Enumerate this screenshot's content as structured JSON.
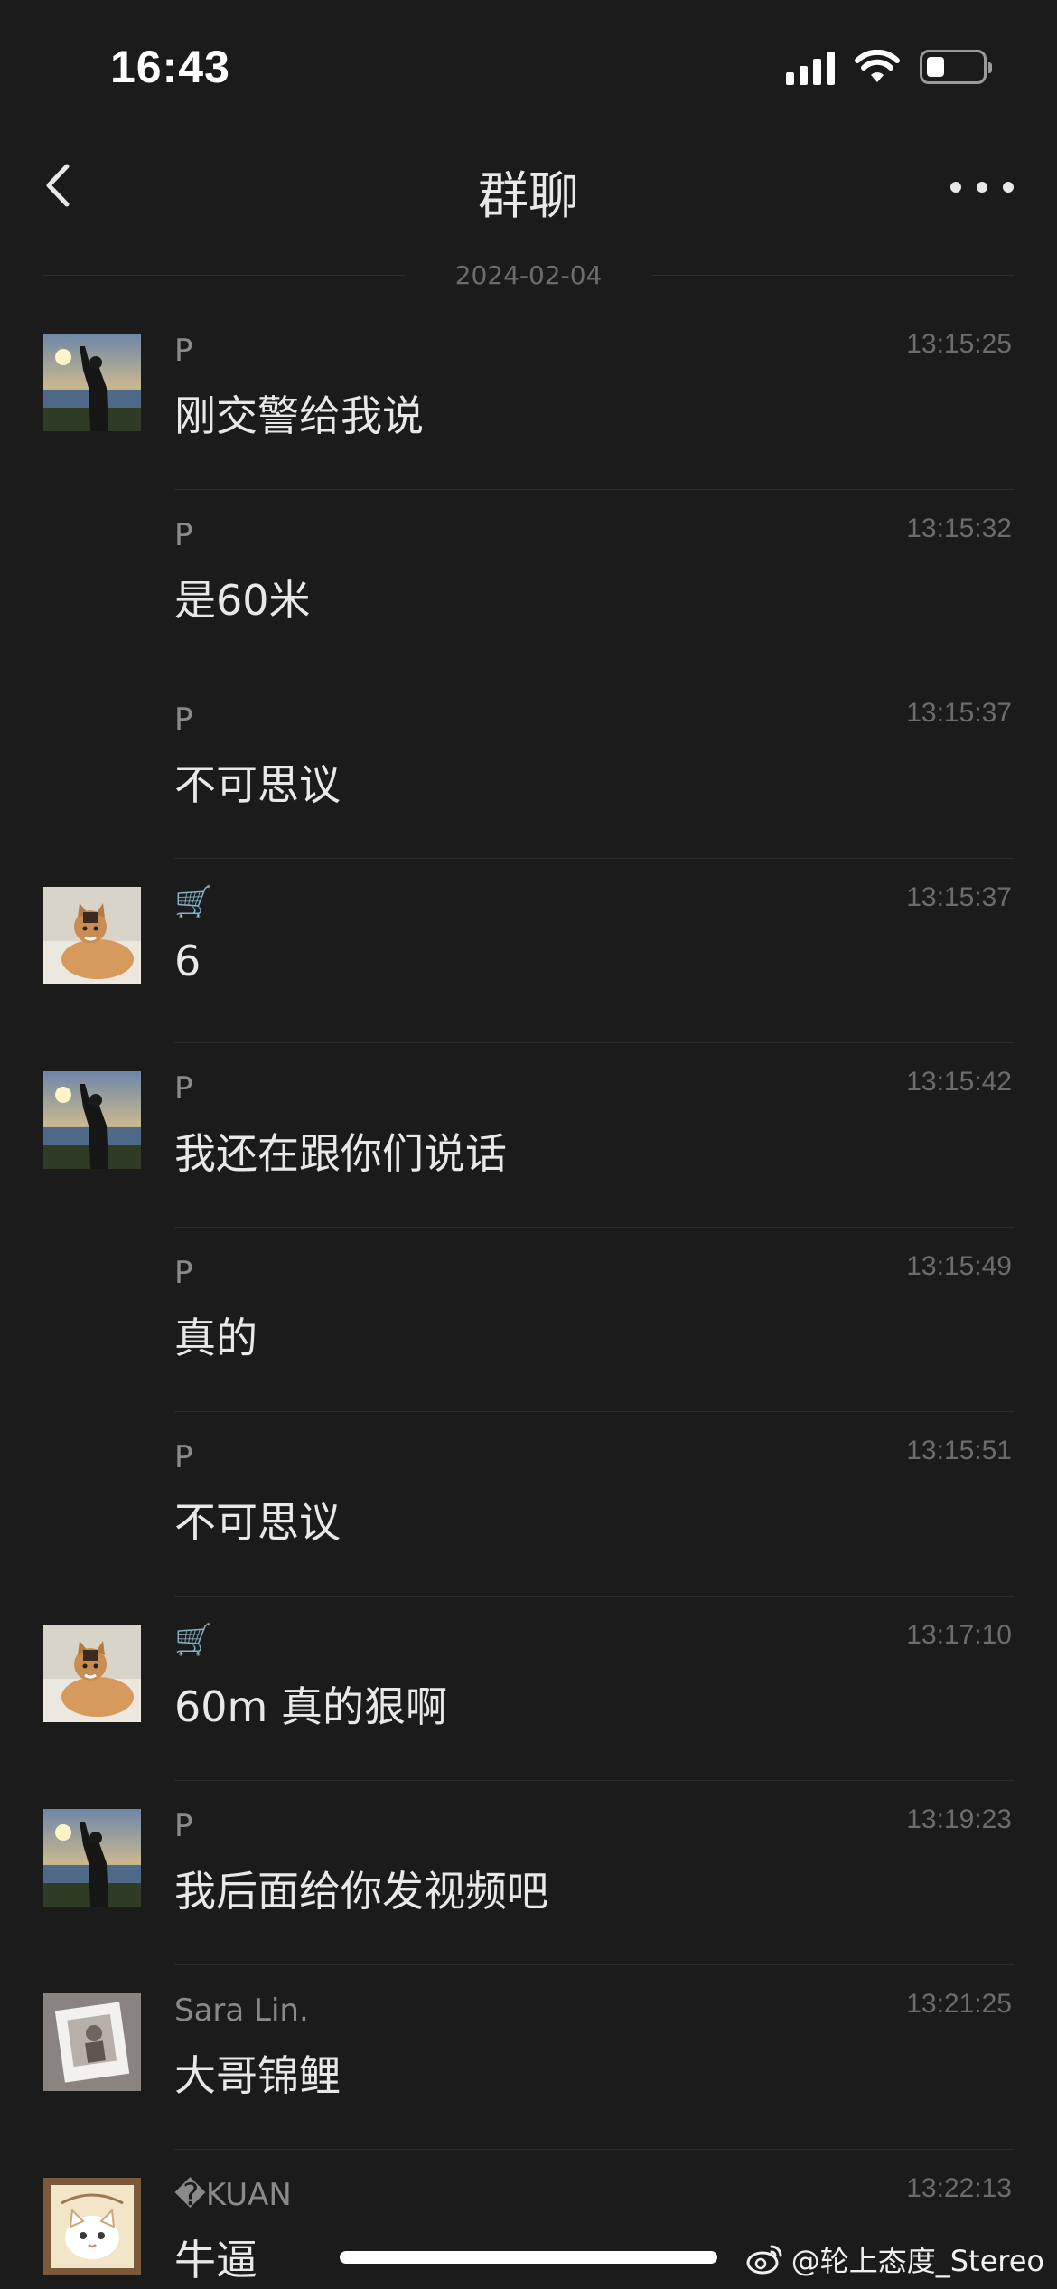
{
  "status_bar": {
    "time": "16:43",
    "battery_level": 0.3
  },
  "nav": {
    "title": "群聊"
  },
  "date_divider": "2024-02-04",
  "messages": [
    {
      "sender": "P",
      "time": "13:15:25",
      "text": "刚交警给我说",
      "avatar": "avatar-person-sunset",
      "show_avatar": true
    },
    {
      "sender": "P",
      "time": "13:15:32",
      "text": "是60米",
      "avatar": "",
      "show_avatar": false
    },
    {
      "sender": "P",
      "time": "13:15:37",
      "text": "不可思议",
      "avatar": "",
      "show_avatar": false
    },
    {
      "sender": "🛒",
      "time": "13:15:37",
      "text": "6",
      "avatar": "avatar-cat",
      "show_avatar": true
    },
    {
      "sender": "P",
      "time": "13:15:42",
      "text": "我还在跟你们说话",
      "avatar": "avatar-person-sunset",
      "show_avatar": true
    },
    {
      "sender": "P",
      "time": "13:15:49",
      "text": "真的",
      "avatar": "",
      "show_avatar": false
    },
    {
      "sender": "P",
      "time": "13:15:51",
      "text": "不可思议",
      "avatar": "",
      "show_avatar": false
    },
    {
      "sender": "🛒",
      "time": "13:17:10",
      "text": "60m 真的狠啊",
      "avatar": "avatar-cat",
      "show_avatar": true
    },
    {
      "sender": "P",
      "time": "13:19:23",
      "text": "我后面给你发视频吧",
      "avatar": "avatar-person-sunset",
      "show_avatar": true
    },
    {
      "sender": "Sara Lin.",
      "time": "13:21:25",
      "text": "大哥锦鲤",
      "avatar": "avatar-photo-frame",
      "show_avatar": true
    },
    {
      "sender": "�KUAN",
      "time": "13:22:13",
      "text": "牛逼",
      "avatar": "avatar-cartoon-cat",
      "show_avatar": true
    }
  ],
  "watermark": {
    "text": "@轮上态度_Stereo",
    "icon": "weibo-icon"
  },
  "colors": {
    "background": "#1b1b1c",
    "text": "#e8e8e8",
    "muted": "#8a8a8c",
    "time": "#6c6c6e",
    "divider": "#2c2c2e"
  }
}
